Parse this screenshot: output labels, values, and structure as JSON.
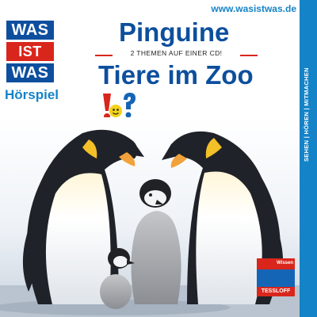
{
  "url": "www.wasistwas.de",
  "side_strip": "SEHEN | HÖREN | MITMACHEN",
  "logo": {
    "row1": "WAS",
    "row2": "IST",
    "row3": "WAS"
  },
  "series_label": "Hörspiel",
  "title_1": "Pinguine",
  "subtitle": "2 THEMEN AUF EINER CD!",
  "title_2": "Tiere im Zoo",
  "publisher": {
    "name": "TESSLOFF",
    "tag": "Wissen"
  },
  "colors": {
    "brand_blue": "#1583c7",
    "logo_blue": "#0d4f9e",
    "accent_red": "#d9261c"
  },
  "icons": [
    "exclamation-mascot-icon",
    "question-mascot-icon"
  ]
}
